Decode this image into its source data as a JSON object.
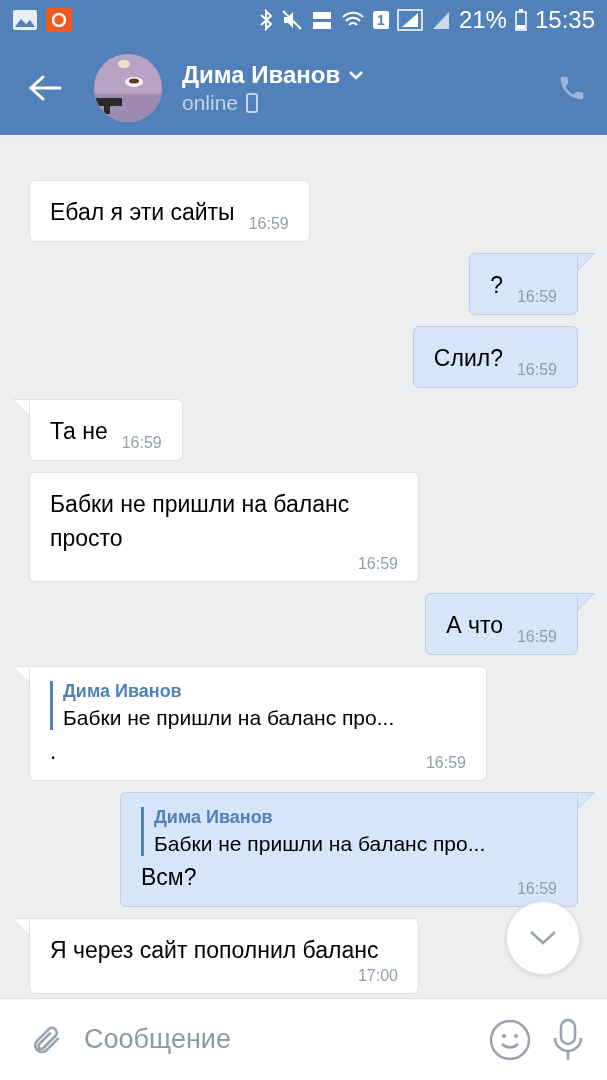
{
  "status_bar": {
    "sim": "1",
    "battery": "21%",
    "time": "15:35"
  },
  "header": {
    "name": "Дима Иванов",
    "status": "online"
  },
  "messages": [
    {
      "kind": "text",
      "outgoing": false,
      "tail": false,
      "text": "Ебал я эти сайты",
      "time": "16:59"
    },
    {
      "kind": "text",
      "outgoing": true,
      "tail": true,
      "text": "?",
      "time": "16:59"
    },
    {
      "kind": "text",
      "outgoing": true,
      "tail": false,
      "text": "Слил?",
      "time": "16:59"
    },
    {
      "kind": "text",
      "outgoing": false,
      "tail": true,
      "text": "Та не",
      "time": "16:59"
    },
    {
      "kind": "text",
      "outgoing": false,
      "tail": false,
      "text": "Бабки не пришли на баланс просто",
      "time": "16:59"
    },
    {
      "kind": "text",
      "outgoing": true,
      "tail": true,
      "text": "А что",
      "time": "16:59"
    },
    {
      "kind": "reply",
      "outgoing": false,
      "tail": true,
      "quote_author": "Дима Иванов",
      "quote_text": "Бабки не пришли на баланс про...",
      "text": ".",
      "time": "16:59"
    },
    {
      "kind": "reply",
      "outgoing": true,
      "tail": true,
      "quote_author": "Дима Иванов",
      "quote_text": "Бабки не пришли на баланс про...",
      "text": "Всм?",
      "time": "16:59"
    },
    {
      "kind": "text",
      "outgoing": false,
      "tail": true,
      "text": "Я через сайт пополнил баланс",
      "time": "17:00"
    }
  ],
  "composer": {
    "placeholder": "Сообщение"
  }
}
